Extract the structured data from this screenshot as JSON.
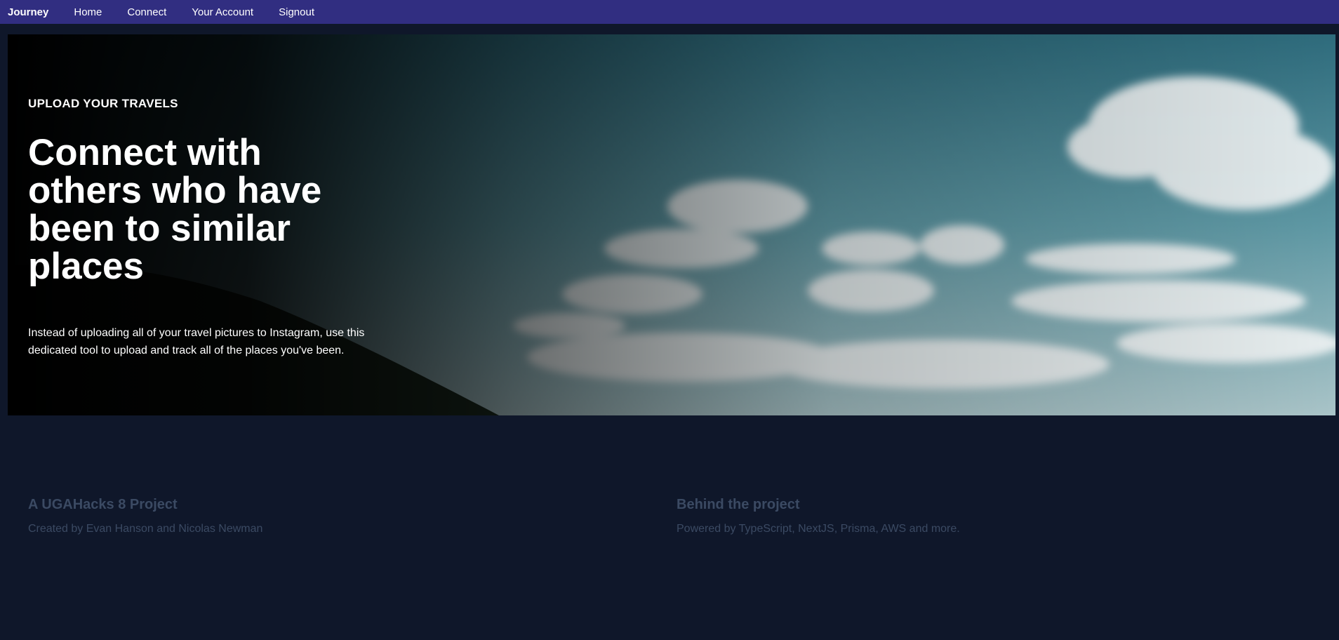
{
  "nav": {
    "brand": "Journey",
    "links": [
      "Home",
      "Connect",
      "Your Account",
      "Signout"
    ]
  },
  "hero": {
    "eyebrow": "UPLOAD YOUR TRAVELS",
    "title": "Connect with others who have been to similar places",
    "description": "Instead of uploading all of your travel pictures to Instagram, use this dedicated tool to upload and track all of the places you've been."
  },
  "info": [
    {
      "title": "A UGAHacks 8 Project",
      "text": "Created by Evan Hanson and Nicolas Newman"
    },
    {
      "title": "Behind the project",
      "text": "Powered by TypeScript, NextJS, Prisma, AWS and more."
    }
  ],
  "colors": {
    "navbar": "#312e81",
    "page_background": "#0f172a",
    "muted_text": "#3b4a63"
  }
}
